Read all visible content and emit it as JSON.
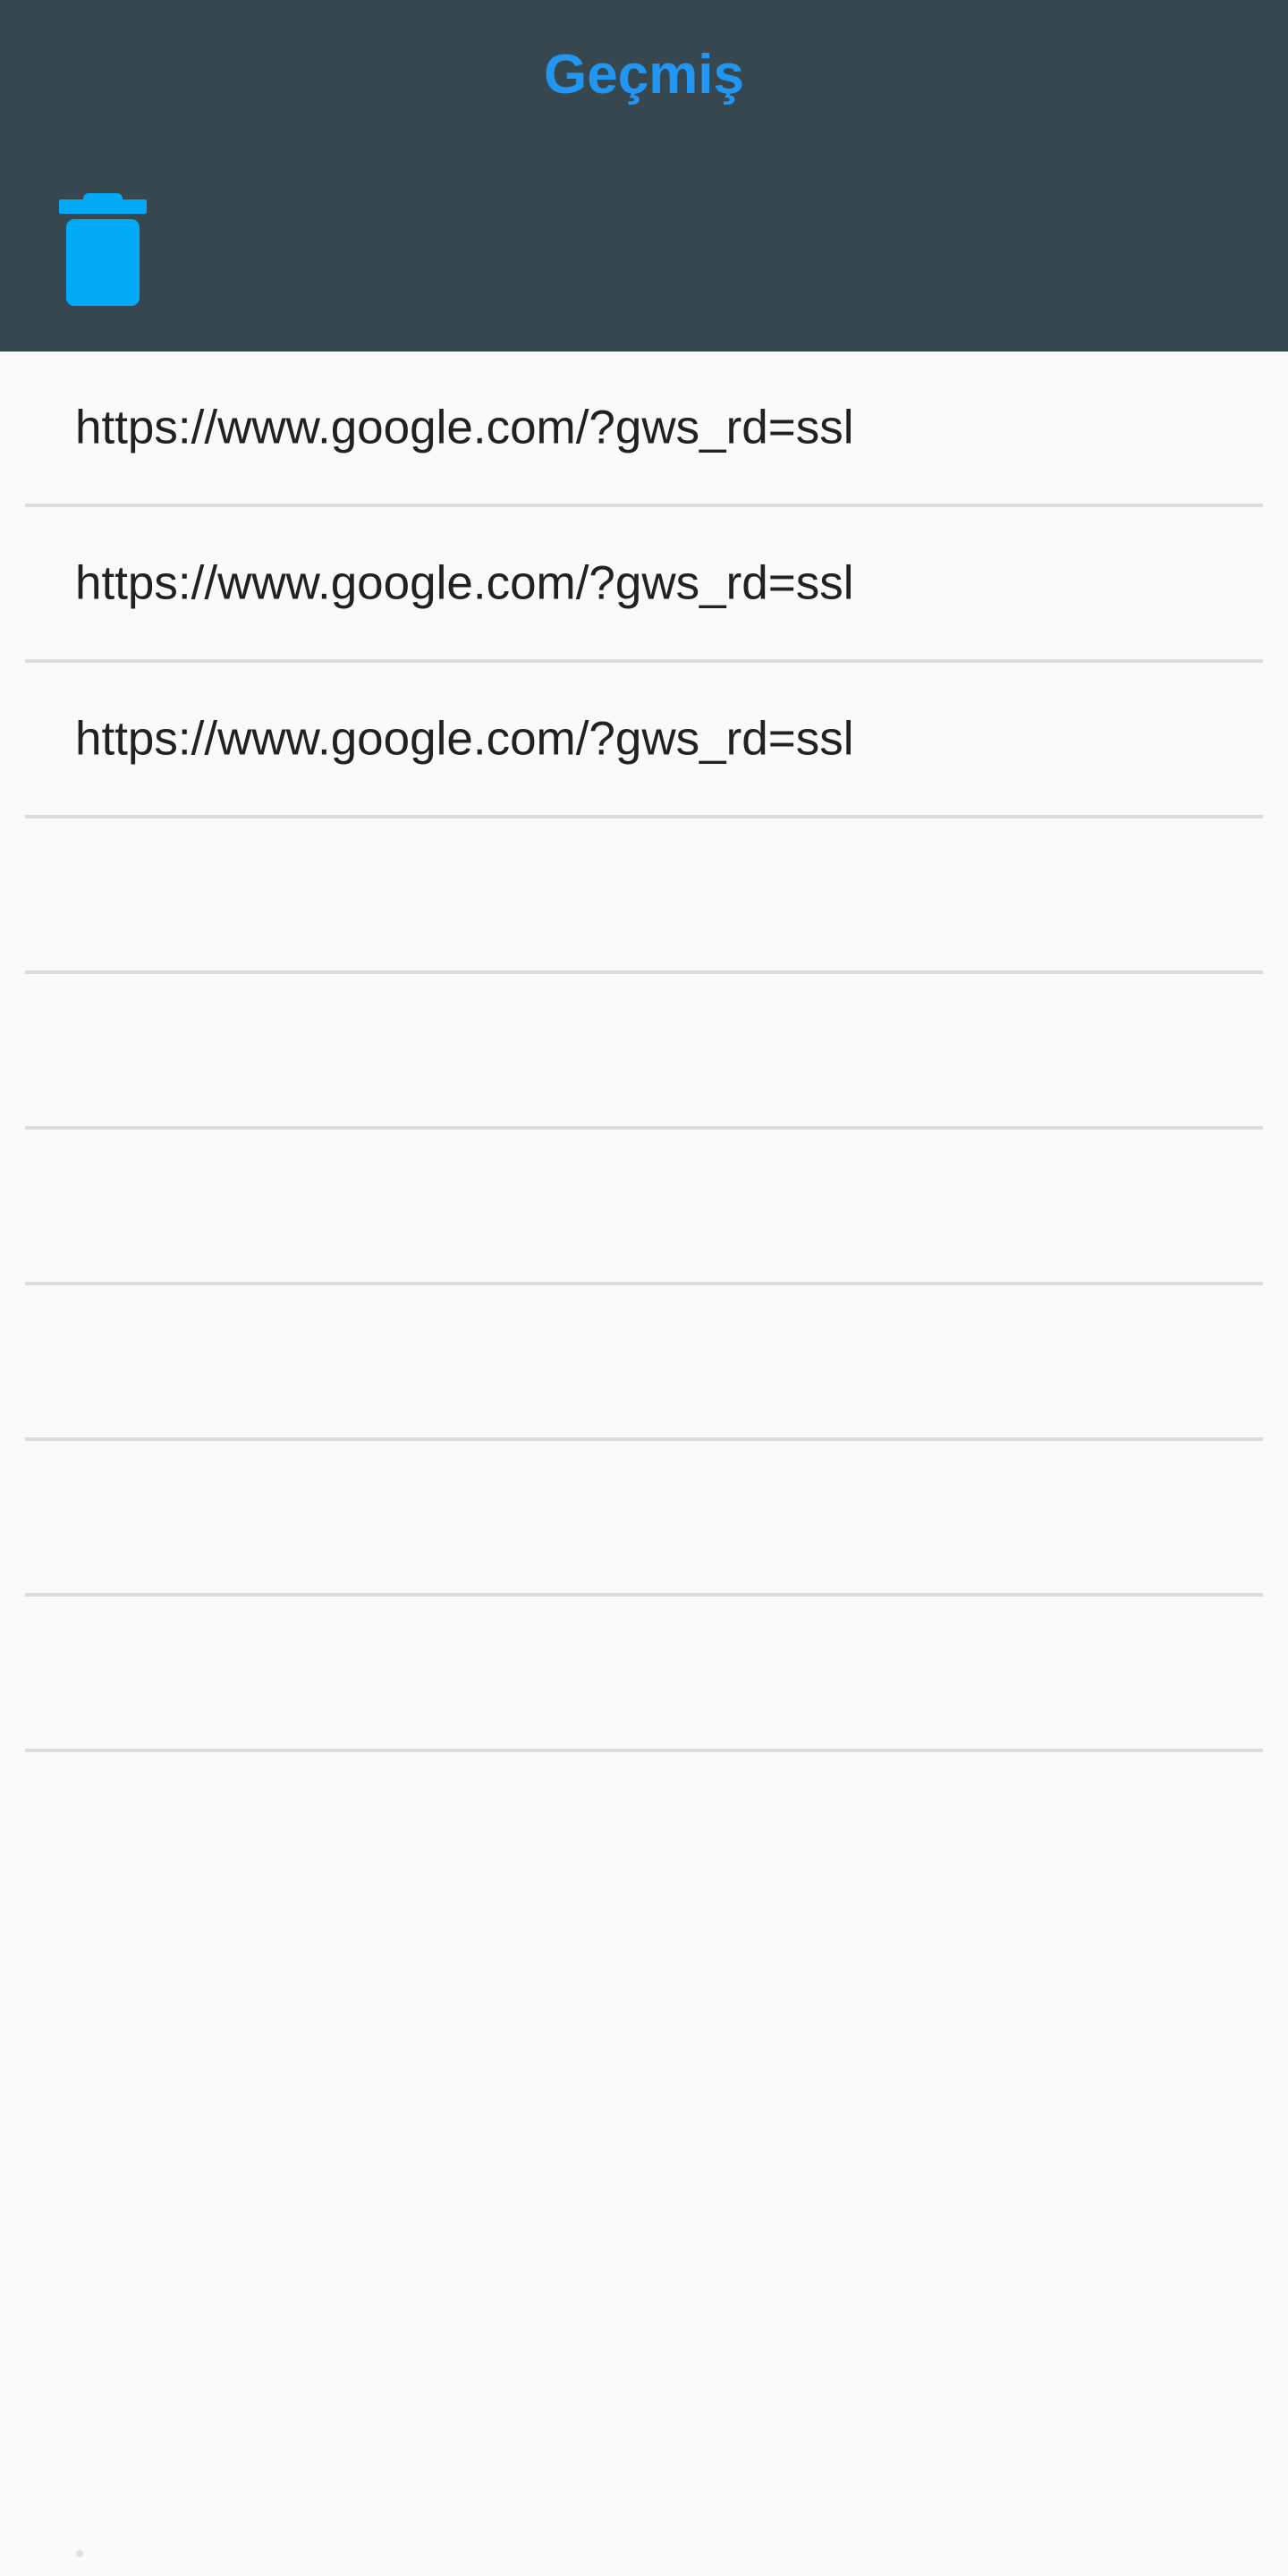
{
  "appbar": {
    "title": "Geçmiş",
    "title_color": "#2196f3",
    "background": "#37474f",
    "delete_icon": "trash-icon",
    "delete_icon_color": "#03a9f4"
  },
  "history": {
    "items": [
      {
        "url": "https://www.google.com/?gws_rd=ssl"
      },
      {
        "url": "https://www.google.com/?gws_rd=ssl"
      },
      {
        "url": "https://www.google.com/?gws_rd=ssl"
      },
      {
        "url": ""
      },
      {
        "url": ""
      },
      {
        "url": ""
      },
      {
        "url": ""
      },
      {
        "url": ""
      },
      {
        "url": ""
      }
    ]
  }
}
